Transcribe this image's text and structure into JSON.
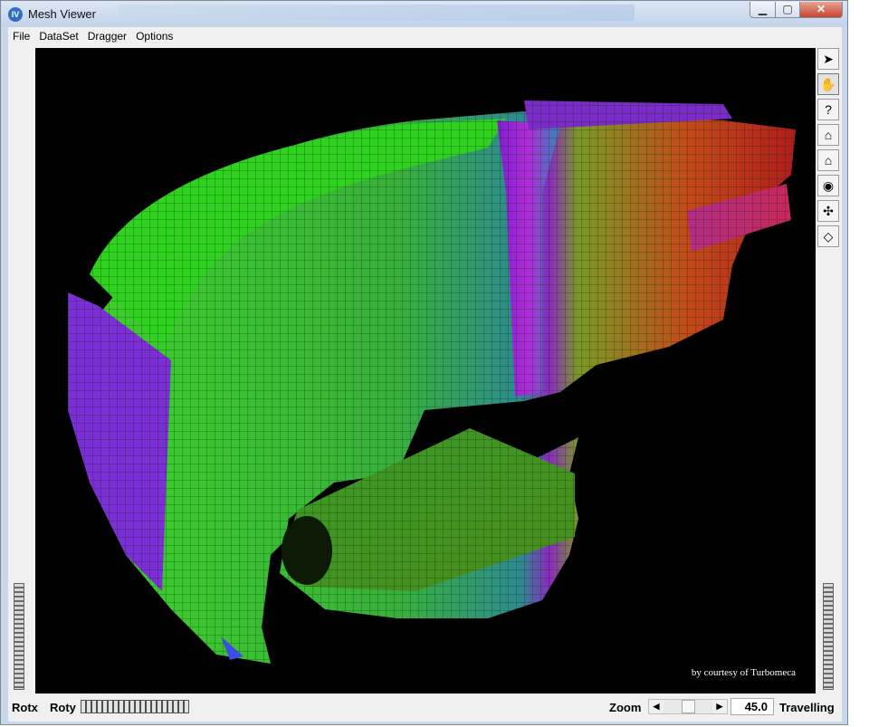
{
  "window": {
    "title": "Mesh Viewer",
    "app_icon": "IV"
  },
  "window_controls": {
    "minimize": "▁",
    "maximize": "▢",
    "close": "✕"
  },
  "menu": [
    "File",
    "DataSet",
    "Dragger",
    "Options"
  ],
  "toolbar": {
    "icons": [
      "select-arrow-icon",
      "hand-icon",
      "help-icon",
      "home-icon",
      "set-home-icon",
      "view-all-icon",
      "seek-icon",
      "projection-icon"
    ],
    "glyphs": [
      "➤",
      "✋",
      "?",
      "⌂",
      "⌂",
      "◉",
      "✣",
      "◇"
    ]
  },
  "viewport": {
    "credit": "by courtesy of Turbomeca"
  },
  "bottom": {
    "rotx_label": "Rotx",
    "roty_label": "Roty",
    "zoom_label": "Zoom",
    "zoom_value": "45.0",
    "travelling_label": "Travelling",
    "left_arrow": "◀",
    "right_arrow": "▶"
  }
}
